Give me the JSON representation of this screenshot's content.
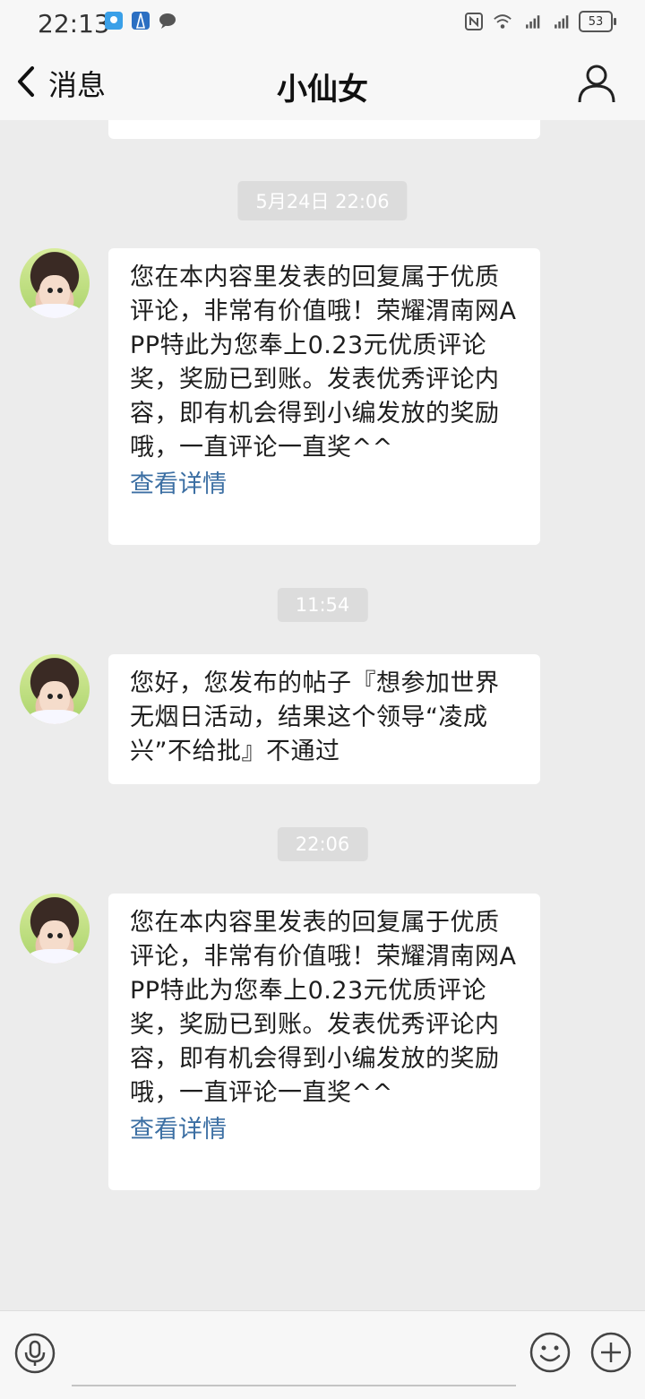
{
  "status_bar": {
    "time": "22:13",
    "battery": "53"
  },
  "navbar": {
    "back_label": "消息",
    "title": "小仙女"
  },
  "messages": [
    {
      "timestamp": "5月24日 22:06",
      "text": "您在本内容里发表的回复属于优质评论，非常有价值哦！荣耀渭南网APP特此为您奉上0.23元优质评论奖，奖励已到账。发表优秀评论内容，即有机会得到小编发放的奖励哦，一直评论一直奖^^",
      "link": "查看详情"
    },
    {
      "timestamp": "11:54",
      "text": "您好，您发布的帖子『想参加世界无烟日活动，结果这个领导“凌成兴”不给批』不通过"
    },
    {
      "timestamp": "22:06",
      "text": "您在本内容里发表的回复属于优质评论，非常有价值哦！荣耀渭南网APP特此为您奉上0.23元优质评论奖，奖励已到账。发表优秀评论内容，即有机会得到小编发放的奖励哦，一直评论一直奖^^",
      "link": "查看详情"
    }
  ],
  "icons": {
    "back": "chevron-left-icon",
    "profile": "person-icon",
    "mic": "microphone-icon",
    "emoji": "smiley-icon",
    "plus": "plus-icon"
  },
  "colors": {
    "link": "#3c6fa3",
    "chat_background": "#ececec",
    "bubble": "#ffffff",
    "timestamp_pill": "#dcdcdc"
  }
}
